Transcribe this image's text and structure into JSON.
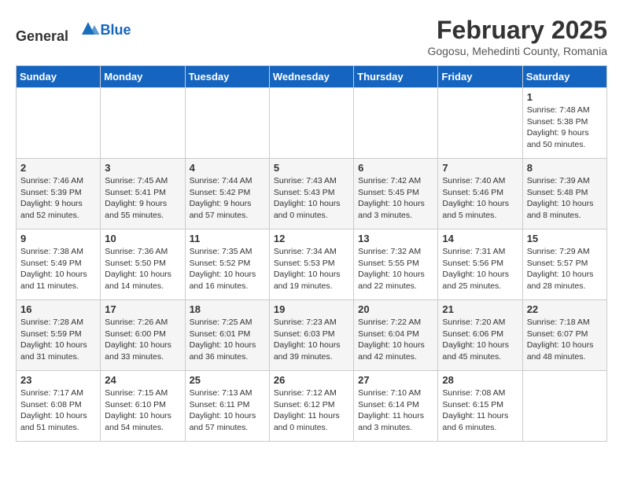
{
  "header": {
    "logo_general": "General",
    "logo_blue": "Blue",
    "title": "February 2025",
    "subtitle": "Gogosu, Mehedinti County, Romania"
  },
  "weekdays": [
    "Sunday",
    "Monday",
    "Tuesday",
    "Wednesday",
    "Thursday",
    "Friday",
    "Saturday"
  ],
  "weeks": [
    [
      {
        "day": "",
        "info": ""
      },
      {
        "day": "",
        "info": ""
      },
      {
        "day": "",
        "info": ""
      },
      {
        "day": "",
        "info": ""
      },
      {
        "day": "",
        "info": ""
      },
      {
        "day": "",
        "info": ""
      },
      {
        "day": "1",
        "info": "Sunrise: 7:48 AM\nSunset: 5:38 PM\nDaylight: 9 hours\nand 50 minutes."
      }
    ],
    [
      {
        "day": "2",
        "info": "Sunrise: 7:46 AM\nSunset: 5:39 PM\nDaylight: 9 hours\nand 52 minutes."
      },
      {
        "day": "3",
        "info": "Sunrise: 7:45 AM\nSunset: 5:41 PM\nDaylight: 9 hours\nand 55 minutes."
      },
      {
        "day": "4",
        "info": "Sunrise: 7:44 AM\nSunset: 5:42 PM\nDaylight: 9 hours\nand 57 minutes."
      },
      {
        "day": "5",
        "info": "Sunrise: 7:43 AM\nSunset: 5:43 PM\nDaylight: 10 hours\nand 0 minutes."
      },
      {
        "day": "6",
        "info": "Sunrise: 7:42 AM\nSunset: 5:45 PM\nDaylight: 10 hours\nand 3 minutes."
      },
      {
        "day": "7",
        "info": "Sunrise: 7:40 AM\nSunset: 5:46 PM\nDaylight: 10 hours\nand 5 minutes."
      },
      {
        "day": "8",
        "info": "Sunrise: 7:39 AM\nSunset: 5:48 PM\nDaylight: 10 hours\nand 8 minutes."
      }
    ],
    [
      {
        "day": "9",
        "info": "Sunrise: 7:38 AM\nSunset: 5:49 PM\nDaylight: 10 hours\nand 11 minutes."
      },
      {
        "day": "10",
        "info": "Sunrise: 7:36 AM\nSunset: 5:50 PM\nDaylight: 10 hours\nand 14 minutes."
      },
      {
        "day": "11",
        "info": "Sunrise: 7:35 AM\nSunset: 5:52 PM\nDaylight: 10 hours\nand 16 minutes."
      },
      {
        "day": "12",
        "info": "Sunrise: 7:34 AM\nSunset: 5:53 PM\nDaylight: 10 hours\nand 19 minutes."
      },
      {
        "day": "13",
        "info": "Sunrise: 7:32 AM\nSunset: 5:55 PM\nDaylight: 10 hours\nand 22 minutes."
      },
      {
        "day": "14",
        "info": "Sunrise: 7:31 AM\nSunset: 5:56 PM\nDaylight: 10 hours\nand 25 minutes."
      },
      {
        "day": "15",
        "info": "Sunrise: 7:29 AM\nSunset: 5:57 PM\nDaylight: 10 hours\nand 28 minutes."
      }
    ],
    [
      {
        "day": "16",
        "info": "Sunrise: 7:28 AM\nSunset: 5:59 PM\nDaylight: 10 hours\nand 31 minutes."
      },
      {
        "day": "17",
        "info": "Sunrise: 7:26 AM\nSunset: 6:00 PM\nDaylight: 10 hours\nand 33 minutes."
      },
      {
        "day": "18",
        "info": "Sunrise: 7:25 AM\nSunset: 6:01 PM\nDaylight: 10 hours\nand 36 minutes."
      },
      {
        "day": "19",
        "info": "Sunrise: 7:23 AM\nSunset: 6:03 PM\nDaylight: 10 hours\nand 39 minutes."
      },
      {
        "day": "20",
        "info": "Sunrise: 7:22 AM\nSunset: 6:04 PM\nDaylight: 10 hours\nand 42 minutes."
      },
      {
        "day": "21",
        "info": "Sunrise: 7:20 AM\nSunset: 6:06 PM\nDaylight: 10 hours\nand 45 minutes."
      },
      {
        "day": "22",
        "info": "Sunrise: 7:18 AM\nSunset: 6:07 PM\nDaylight: 10 hours\nand 48 minutes."
      }
    ],
    [
      {
        "day": "23",
        "info": "Sunrise: 7:17 AM\nSunset: 6:08 PM\nDaylight: 10 hours\nand 51 minutes."
      },
      {
        "day": "24",
        "info": "Sunrise: 7:15 AM\nSunset: 6:10 PM\nDaylight: 10 hours\nand 54 minutes."
      },
      {
        "day": "25",
        "info": "Sunrise: 7:13 AM\nSunset: 6:11 PM\nDaylight: 10 hours\nand 57 minutes."
      },
      {
        "day": "26",
        "info": "Sunrise: 7:12 AM\nSunset: 6:12 PM\nDaylight: 11 hours\nand 0 minutes."
      },
      {
        "day": "27",
        "info": "Sunrise: 7:10 AM\nSunset: 6:14 PM\nDaylight: 11 hours\nand 3 minutes."
      },
      {
        "day": "28",
        "info": "Sunrise: 7:08 AM\nSunset: 6:15 PM\nDaylight: 11 hours\nand 6 minutes."
      },
      {
        "day": "",
        "info": ""
      }
    ]
  ]
}
